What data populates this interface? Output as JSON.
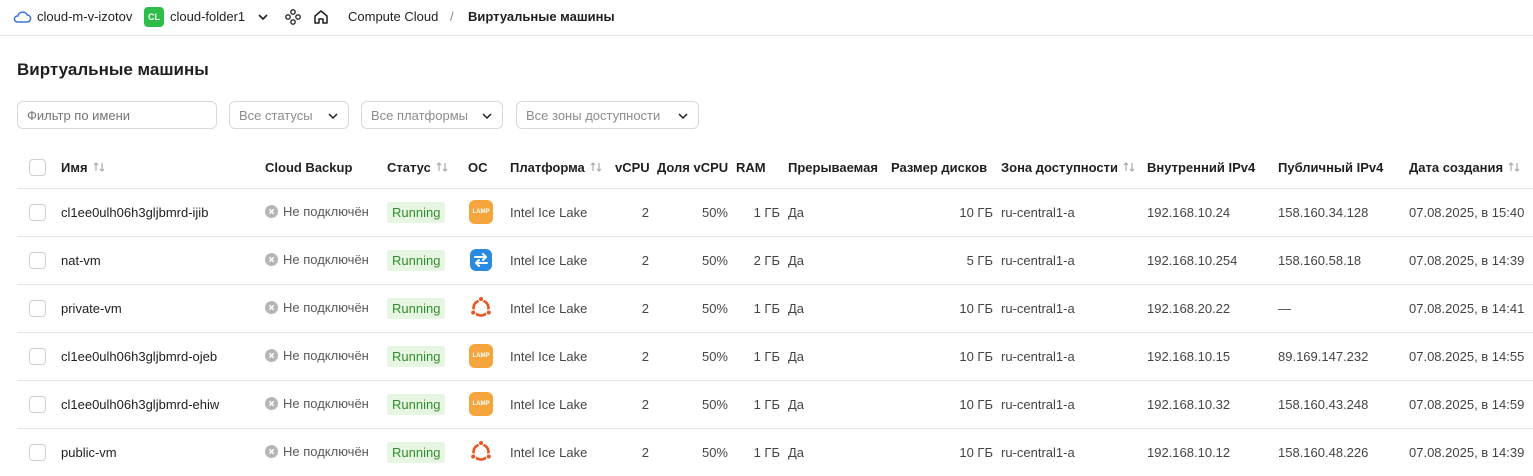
{
  "header": {
    "cloud_name": "cloud-m-v-izotov",
    "folder_badge": "CL",
    "folder_name": "cloud-folder1",
    "breadcrumb_service": "Compute Cloud",
    "breadcrumb_separator": "/",
    "breadcrumb_current": "Виртуальные машины",
    "folder_badge_color": "#2ebd4b"
  },
  "page": {
    "title": "Виртуальные машины"
  },
  "filters": {
    "name_placeholder": "Фильтр по имени",
    "status_select": "Все статусы",
    "platform_select": "Все платформы",
    "zone_select": "Все зоны доступности"
  },
  "table": {
    "columns": [
      "Имя",
      "Cloud Backup",
      "Статус",
      "ОС",
      "Платформа",
      "vCPU",
      "Доля vCPU",
      "RAM",
      "Прерываемая",
      "Размер дисков",
      "Зона доступности",
      "Внутренний IPv4",
      "Публичный IPv4",
      "Дата создания"
    ],
    "rows": [
      {
        "name": "cl1ee0ulh06h3gljbmrd-ijib",
        "backup": "Не подключён",
        "status": "Running",
        "os": "lamp-icon",
        "platform": "Intel Ice Lake",
        "vcpu": "2",
        "vcpu_share": "50%",
        "ram": "1 ГБ",
        "preemptible": "Да",
        "disk": "10 ГБ",
        "zone": "ru-central1-a",
        "ip_internal": "192.168.10.24",
        "ip_public": "158.160.34.128",
        "created": "07.08.2025, в 15:40"
      },
      {
        "name": "nat-vm",
        "backup": "Не подключён",
        "status": "Running",
        "os": "nat-instance-icon",
        "platform": "Intel Ice Lake",
        "vcpu": "2",
        "vcpu_share": "50%",
        "ram": "2 ГБ",
        "preemptible": "Да",
        "disk": "5 ГБ",
        "zone": "ru-central1-a",
        "ip_internal": "192.168.10.254",
        "ip_public": "158.160.58.18",
        "created": "07.08.2025, в 14:39"
      },
      {
        "name": "private-vm",
        "backup": "Не подключён",
        "status": "Running",
        "os": "ubuntu-icon",
        "platform": "Intel Ice Lake",
        "vcpu": "2",
        "vcpu_share": "50%",
        "ram": "1 ГБ",
        "preemptible": "Да",
        "disk": "10 ГБ",
        "zone": "ru-central1-a",
        "ip_internal": "192.168.20.22",
        "ip_public": "—",
        "created": "07.08.2025, в 14:41"
      },
      {
        "name": "cl1ee0ulh06h3gljbmrd-ojeb",
        "backup": "Не подключён",
        "status": "Running",
        "os": "lamp-icon",
        "platform": "Intel Ice Lake",
        "vcpu": "2",
        "vcpu_share": "50%",
        "ram": "1 ГБ",
        "preemptible": "Да",
        "disk": "10 ГБ",
        "zone": "ru-central1-a",
        "ip_internal": "192.168.10.15",
        "ip_public": "89.169.147.232",
        "created": "07.08.2025, в 14:55"
      },
      {
        "name": "cl1ee0ulh06h3gljbmrd-ehiw",
        "backup": "Не подключён",
        "status": "Running",
        "os": "lamp-icon",
        "platform": "Intel Ice Lake",
        "vcpu": "2",
        "vcpu_share": "50%",
        "ram": "1 ГБ",
        "preemptible": "Да",
        "disk": "10 ГБ",
        "zone": "ru-central1-a",
        "ip_internal": "192.168.10.32",
        "ip_public": "158.160.43.248",
        "created": "07.08.2025, в 14:59"
      },
      {
        "name": "public-vm",
        "backup": "Не подключён",
        "status": "Running",
        "os": "ubuntu-icon",
        "platform": "Intel Ice Lake",
        "vcpu": "2",
        "vcpu_share": "50%",
        "ram": "1 ГБ",
        "preemptible": "Да",
        "disk": "10 ГБ",
        "zone": "ru-central1-a",
        "ip_internal": "192.168.10.12",
        "ip_public": "158.160.48.226",
        "created": "07.08.2025, в 14:39"
      }
    ],
    "lamp_label": "LAMP",
    "status_color": "#2f8f2a"
  }
}
